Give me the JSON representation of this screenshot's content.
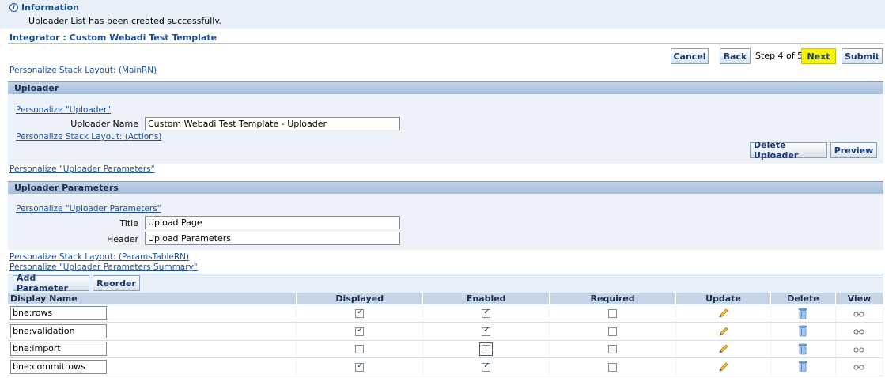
{
  "info": {
    "title": "Information",
    "message": "Uploader List has been created successfully."
  },
  "page_title": "Integrator : Custom Webadi Test Template",
  "nav": {
    "cancel": "Cancel",
    "back": "Back",
    "step": "Step 4 of 5",
    "next": "Next",
    "submit": "Submit"
  },
  "links": {
    "stack_main": "Personalize Stack Layout: (MainRN)",
    "personalize_uploader": "Personalize \"Uploader\"",
    "stack_actions": "Personalize Stack Layout: (Actions)",
    "personalize_params_outer": "Personalize \"Uploader Parameters\"",
    "personalize_params_inner": "Personalize \"Uploader Parameters\"",
    "stack_params_table": "Personalize Stack Layout: (ParamsTableRN)",
    "params_summary": "Personalize \"Uploader Parameters Summary\""
  },
  "uploader": {
    "header": "Uploader",
    "name_label": "Uploader Name",
    "name_value": "Custom Webadi Test Template - Uploader",
    "delete_button": "Delete Uploader",
    "preview_button": "Preview"
  },
  "params": {
    "header": "Uploader Parameters",
    "title_label": "Title",
    "title_value": "Upload Page",
    "header_label": "Header",
    "header_value": "Upload Parameters"
  },
  "table": {
    "add_button": "Add Parameter",
    "reorder_button": "Reorder",
    "columns": [
      "Display Name",
      "Displayed",
      "Enabled",
      "Required",
      "Update",
      "Delete",
      "View"
    ],
    "rows": [
      {
        "name": "bne:rows",
        "displayed": true,
        "enabled": true,
        "required": false
      },
      {
        "name": "bne:validation",
        "displayed": true,
        "enabled": true,
        "required": false
      },
      {
        "name": "bne:import",
        "displayed": false,
        "enabled": false,
        "required": false
      },
      {
        "name": "bne:commitrows",
        "displayed": true,
        "enabled": true,
        "required": false
      }
    ]
  },
  "colors": {
    "header_blue": "#1a5194",
    "highlight": "#f7f400"
  }
}
